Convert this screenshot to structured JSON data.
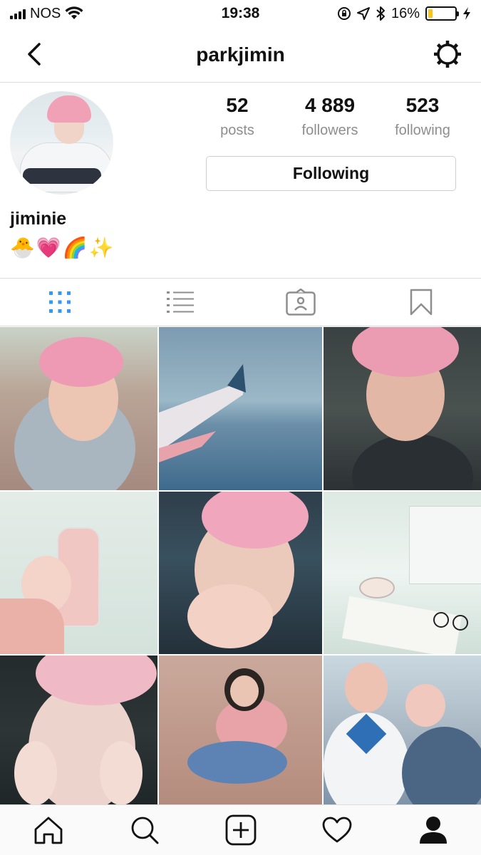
{
  "status_bar": {
    "carrier": "NOS",
    "time": "19:38",
    "battery_percent": "16%",
    "battery_level": 0.16,
    "battery_color": "#f5c518",
    "icons": [
      "signal-icon",
      "wifi-icon",
      "orientation-lock-icon",
      "location-icon",
      "bluetooth-icon",
      "battery-icon",
      "charging-icon"
    ]
  },
  "header": {
    "username": "parkjimin",
    "back_icon": "chevron-left-icon",
    "settings_icon": "gear-icon"
  },
  "profile": {
    "stats": [
      {
        "value": "52",
        "label": "posts"
      },
      {
        "value": "4 889",
        "label": "followers"
      },
      {
        "value": "523",
        "label": "following"
      }
    ],
    "follow_button_label": "Following",
    "display_name": "jiminie",
    "bio": "🐣💗🌈✨"
  },
  "tabs": [
    {
      "name": "grid-view",
      "icon": "grid-icon",
      "active": true,
      "color": "#3897f0"
    },
    {
      "name": "list-view",
      "icon": "list-icon",
      "active": false
    },
    {
      "name": "tagged",
      "icon": "tagged-user-icon",
      "active": false
    },
    {
      "name": "saved",
      "icon": "bookmark-icon",
      "active": false
    }
  ],
  "posts": [
    {
      "id": "post-1"
    },
    {
      "id": "post-2"
    },
    {
      "id": "post-3"
    },
    {
      "id": "post-4"
    },
    {
      "id": "post-5"
    },
    {
      "id": "post-6"
    },
    {
      "id": "post-7"
    },
    {
      "id": "post-8"
    },
    {
      "id": "post-9"
    }
  ],
  "bottom_nav": [
    {
      "name": "home",
      "icon": "home-icon"
    },
    {
      "name": "search",
      "icon": "search-icon"
    },
    {
      "name": "new-post",
      "icon": "add-post-icon"
    },
    {
      "name": "activity",
      "icon": "heart-icon"
    },
    {
      "name": "profile",
      "icon": "profile-icon",
      "active": true
    }
  ]
}
